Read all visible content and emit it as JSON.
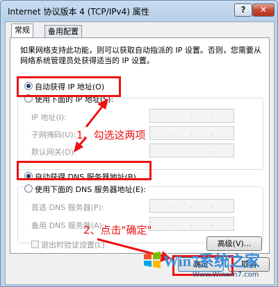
{
  "window": {
    "title": "Internet 协议版本 4 (TCP/IPv4) 属性",
    "help_label": "?",
    "close_label": "✕"
  },
  "tabs": [
    {
      "label": "常规",
      "active": true
    },
    {
      "label": "备用配置",
      "active": false
    }
  ],
  "description": "如果网络支持此功能，则可以获取自动指派的 IP 设置。否则，您需要从网络系统管理员处获得适当的 IP 设置。",
  "ip": {
    "auto_label": "自动获得 IP 地址(O)",
    "auto_selected": true,
    "manual_label": "使用下面的 IP 地址(S):",
    "fields": [
      {
        "label": "IP 地址(I):"
      },
      {
        "label": "子网掩码(U):"
      },
      {
        "label": "默认网关(D):"
      }
    ]
  },
  "dns": {
    "auto_label": "自动获得 DNS 服务器地址(B)",
    "auto_selected": true,
    "manual_label": "使用下面的 DNS 服务器地址(E):",
    "fields": [
      {
        "label": "首选 DNS 服务器(P):"
      },
      {
        "label": "备用 DNS 服务器(A):"
      }
    ]
  },
  "validate_label": "退出时验证设置(L)",
  "buttons": {
    "advanced": "高级(V)...",
    "ok": "确定",
    "cancel": "取消"
  },
  "annotations": {
    "step1": "1、勾选这两项",
    "step2": "2、点击\"确定\""
  },
  "watermark": {
    "brand": "Win7系统之家",
    "url": "Www.Winwin7.com"
  },
  "colors": {
    "annotation_red": "#ee1111",
    "title_bg": "#c9dcf0"
  }
}
